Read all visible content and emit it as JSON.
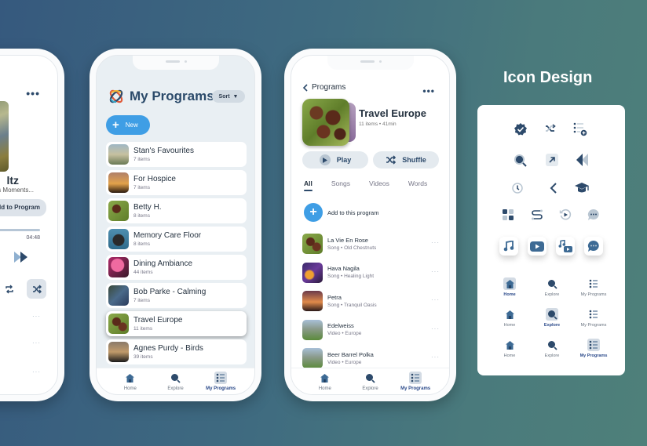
{
  "colors": {
    "primary": "#2d4a6b",
    "accent_blue": "#3f9ee5",
    "muted": "#b9c6d2",
    "chip_bg": "#dde3ea",
    "bg_gradient_start": "#36597e",
    "bg_gradient_end": "#4e807a"
  },
  "now_playing": {
    "title_partial": "ltz",
    "subtitle_partial": "s Moments...",
    "add_button_label": "ld to Program",
    "duration": "04:48",
    "progress": 0.95,
    "more_icon": "more-dots-icon",
    "repeat_icon": "repeat-icon",
    "shuffle_icon": "shuffle-icon",
    "forward_icon": "fast-forward-icon",
    "row_more": [
      "···",
      "···",
      "···"
    ]
  },
  "my_programs": {
    "title": "My Programs",
    "sort_label": "Sort",
    "new_label": "New",
    "items": [
      {
        "name": "Stan's Favourites",
        "count": "7 items"
      },
      {
        "name": "For Hospice",
        "count": "7 items"
      },
      {
        "name": "Betty H.",
        "count": "8 items"
      },
      {
        "name": "Memory Care Floor",
        "count": "8 items"
      },
      {
        "name": "Dining Ambiance",
        "count": "44 items"
      },
      {
        "name": "Bob Parke - Calming",
        "count": "7 items"
      },
      {
        "name": "Travel Europe",
        "count": "11 items",
        "active": true
      },
      {
        "name": "Agnes Purdy - Birds",
        "count": "39 items"
      }
    ]
  },
  "tabbar": {
    "home": "Home",
    "explore": "Explore",
    "my_programs": "My Programs",
    "active": "my_programs"
  },
  "program_detail": {
    "back_label": "Programs",
    "title": "Travel Europe",
    "meta": "11 items • 41min",
    "play_label": "Play",
    "shuffle_label": "Shuffle",
    "tabs": [
      "All",
      "Songs",
      "Videos",
      "Words"
    ],
    "active_tab": "All",
    "add_label": "Add to this program",
    "items": [
      {
        "name": "La Vie En Rose",
        "sub": "Song • Old Chestnuts",
        "more": "···"
      },
      {
        "name": "Hava Nagila",
        "sub": "Song • Healing Light",
        "more": "···"
      },
      {
        "name": "Petra",
        "sub": "Song • Tranquil Oasis",
        "more": "···"
      },
      {
        "name": "Edelweiss",
        "sub": "Video • Europe",
        "more": "···"
      },
      {
        "name": "Beer Barrel Polka",
        "sub": "Video • Europe",
        "more": "···"
      }
    ]
  },
  "icon_design": {
    "heading": "Icon Design",
    "rows": [
      [
        "verified-badge-icon",
        "shuffle-icon",
        "add-to-list-icon"
      ],
      [
        "search-icon",
        "external-link-icon",
        "rewind-icon"
      ],
      [
        "history-icon",
        "chevron-left-icon",
        "graduation-cap-icon"
      ],
      [
        "dashboard-icon",
        "route-icon",
        "replay-icon",
        "chat-icon"
      ],
      [
        "music-note-icon",
        "video-play-icon",
        "music-video-icon",
        "chat-bubble-icon"
      ]
    ],
    "nav_variants": [
      {
        "active": "home",
        "labels": [
          "Home",
          "Explore",
          "My Programs"
        ]
      },
      {
        "active": "explore",
        "labels": [
          "Home",
          "Explore",
          "My Programs"
        ]
      },
      {
        "active": "my_programs",
        "labels": [
          "Home",
          "Explore",
          "My Programs"
        ]
      }
    ]
  }
}
